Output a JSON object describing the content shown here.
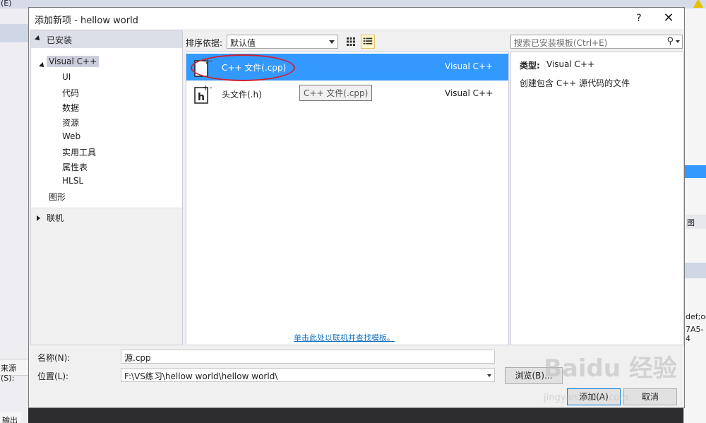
{
  "ide": {
    "menu_e": "(E)",
    "source_label": "来源(S):",
    "output_tab": "输出",
    "right_tab": "图",
    "right_text1": "def;oc",
    "right_text2": "7A5-4"
  },
  "dialog": {
    "title": "添加新项 - hellow world",
    "help": "?",
    "close": "✕"
  },
  "tree": {
    "installed": "已安装",
    "visual_cpp": "Visual C++",
    "children": [
      "UI",
      "代码",
      "数据",
      "资源",
      "Web",
      "实用工具",
      "属性表",
      "HLSL"
    ],
    "graphics": "图形",
    "online": "联机"
  },
  "sort": {
    "label": "排序依据:",
    "value": "默认值"
  },
  "search": {
    "placeholder": "搜索已安装模板(Ctrl+E)"
  },
  "templates": [
    {
      "name": "C++ 文件(.cpp)",
      "lang": "Visual C++"
    },
    {
      "name": "头文件(.h)",
      "lang": "Visual C++"
    }
  ],
  "tooltip": "C++ 文件(.cpp)",
  "online_link": "单击此处以联机并查找模板。",
  "details": {
    "type_label": "类型:",
    "type_value": "Visual C++",
    "description": "创建包含 C++ 源代码的文件"
  },
  "form": {
    "name_label": "名称(N):",
    "name_value": "源.cpp",
    "location_label": "位置(L):",
    "location_value": "F:\\VS练习\\hellow world\\hellow world\\",
    "browse_button": "浏览(B)...",
    "add_button": "添加(A)",
    "cancel_button": "取消"
  },
  "watermark": {
    "logo": "Baidu 经验",
    "url": "jingyan.baidu.com"
  },
  "colors": {
    "selection": "#3399ff",
    "accent": "#0078d7",
    "annotation": "#cc2233"
  }
}
